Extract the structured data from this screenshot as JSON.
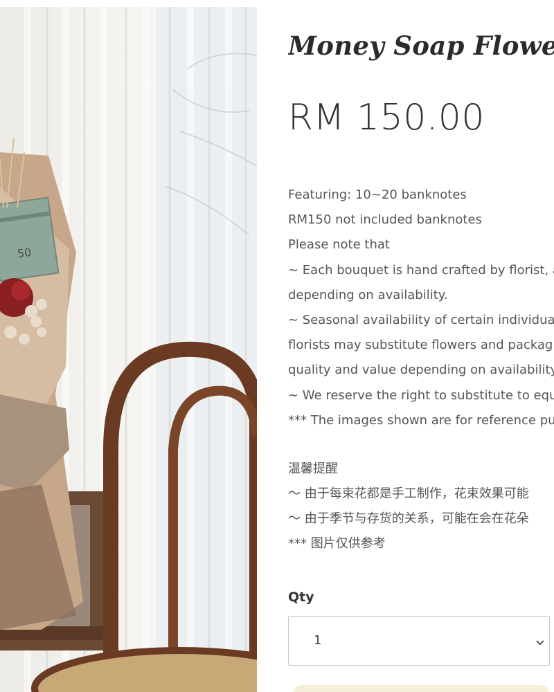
{
  "product": {
    "title": "Money Soap Flower B",
    "price": "RM 150.00"
  },
  "description": {
    "lines": [
      "Featuring: 10~20 banknotes",
      "RM150 not included banknotes",
      "Please note that",
      "~ Each bouquet is hand crafted by florist, a",
      "depending on availability.",
      "~ Seasonal availability of certain individual",
      "florists may substitute flowers and packagi",
      "quality and value depending on availability.",
      "~ We reserve the right to substitute to equ",
      "*** The images shown are for reference pu"
    ]
  },
  "notes_zh": {
    "lines": [
      "温馨提醒",
      "〜 由于每束花都是手工制作，花束效果可能",
      "〜 由于季节与存货的关系，可能在会在花朵",
      "*** 图片仅供参考"
    ]
  },
  "quantity": {
    "label": "Qty",
    "value": "1",
    "icon": "chevron-down-icon"
  },
  "colors": {
    "text": "#333333",
    "muted": "#555555",
    "border": "#c8c8c8",
    "button_peek": "#f5eed9"
  }
}
